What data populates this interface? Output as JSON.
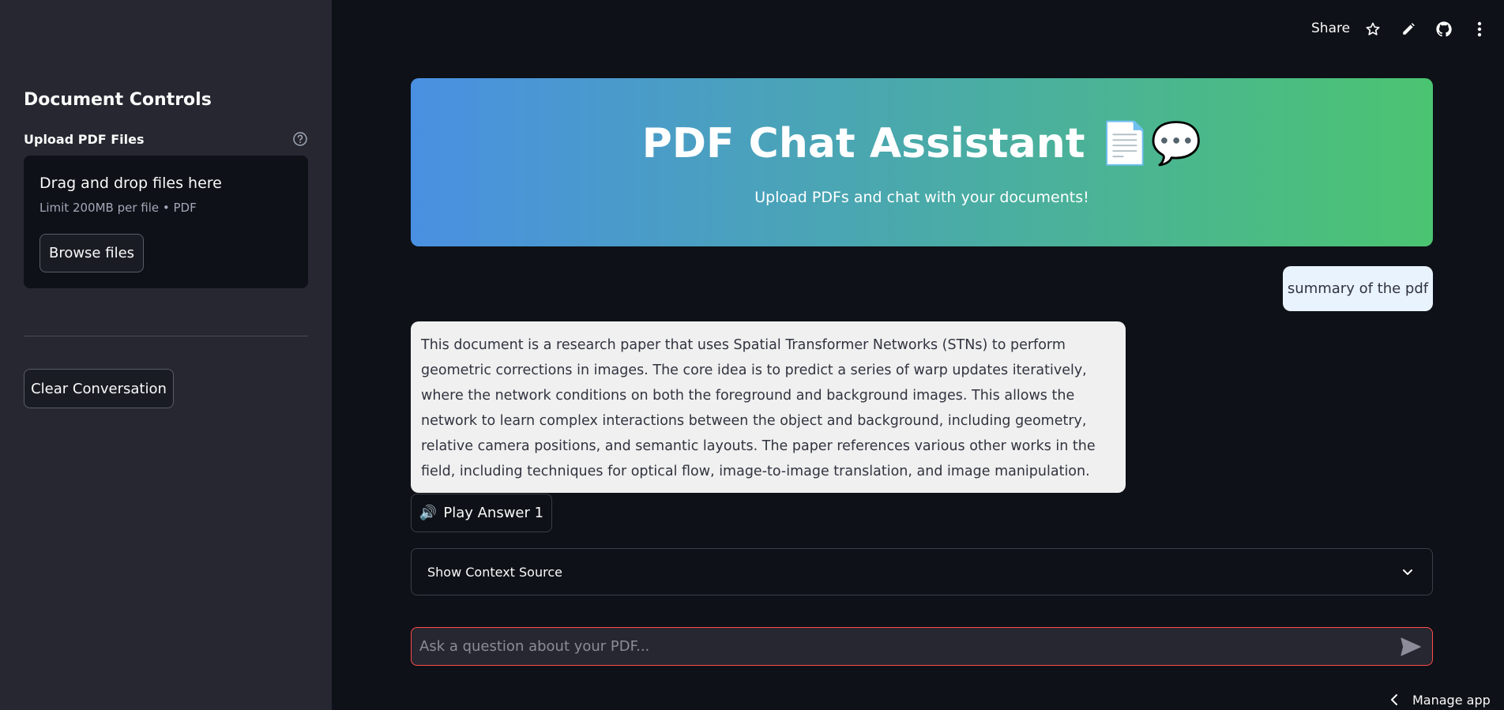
{
  "sidebar": {
    "title": "Document Controls",
    "upload_label": "Upload PDF Files",
    "dropzone_title": "Drag and drop files here",
    "dropzone_limit": "Limit 200MB per file • PDF",
    "browse_label": "Browse files",
    "clear_label": "Clear Conversation"
  },
  "toolbar": {
    "share_label": "Share",
    "icons": [
      "star-icon",
      "pencil-icon",
      "github-icon",
      "more-vertical-icon"
    ]
  },
  "header": {
    "title": "PDF Chat Assistant 📄💬",
    "subtitle": "Upload PDFs and chat with your documents!"
  },
  "chat": {
    "user_message": "summary of the pdf",
    "bot_message": "This document is a research paper that uses Spatial Transformer Networks (STNs) to perform geometric corrections in images. The core idea is to predict a series of warp updates iteratively, where the network conditions on both the foreground and background images. This allows the network to learn complex interactions between the object and background, including geometry, relative camera positions, and semantic layouts. The paper references various other works in the field, including techniques for optical flow, image-to-image translation, and image manipulation.",
    "play_label": "Play Answer 1",
    "play_icon": "🔊",
    "expander_label": "Show Context Source"
  },
  "input": {
    "placeholder": "Ask a question about your PDF..."
  },
  "footer": {
    "manage_label": "Manage app"
  },
  "colors": {
    "background": "#0e1117",
    "sidebar": "#262730",
    "banner_start": "#4a90e2",
    "banner_end": "#4bc471",
    "input_border": "#ff4b4b",
    "user_bubble": "#e8f3fd",
    "bot_bubble": "#f0f0f0"
  }
}
